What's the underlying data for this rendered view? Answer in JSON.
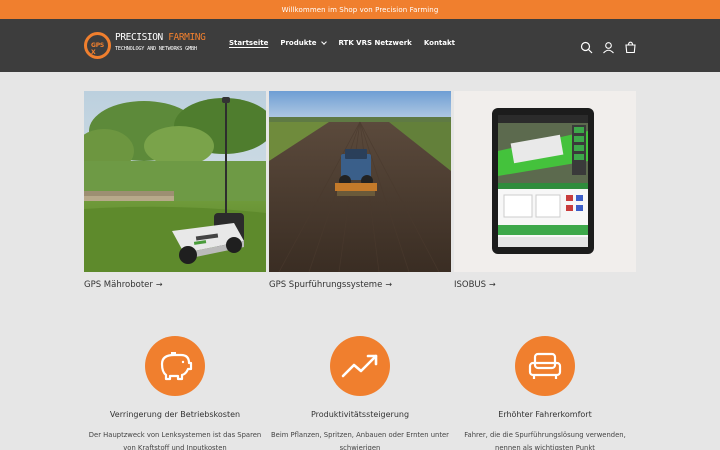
{
  "announcement": "Willkommen im Shop von Precision Farming",
  "logo": {
    "mark": "GPS X",
    "line1_a": "PRECISION ",
    "line1_b": "FARMING",
    "line2": "TECHNOLOGY AND NETWORKS GMBH"
  },
  "nav": {
    "items": [
      {
        "label": "Startseite",
        "active": true
      },
      {
        "label": "Produkte",
        "dropdown": true
      },
      {
        "label": "RTK VRS Netzwerk"
      },
      {
        "label": "Kontakt"
      }
    ]
  },
  "header_icons": [
    "search-icon",
    "account-icon",
    "cart-icon"
  ],
  "collections": [
    {
      "title": "GPS Mähroboter",
      "image": "robot-mower-lawn"
    },
    {
      "title": "GPS Spurführungssysteme",
      "image": "tractor-field"
    },
    {
      "title": "ISOBUS",
      "image": "isobus-tablet"
    }
  ],
  "features": [
    {
      "title": "Verringerung der Betriebskosten",
      "text": "Der Hauptzweck von Lenksystemen ist das Sparen von Kraftstoff und Inputkosten",
      "icon": "piggy-bank-icon"
    },
    {
      "title": "Produktivitätssteigerung",
      "text": "Beim Pflanzen, Spritzen, Anbauen oder Ernten unter schwierigen",
      "icon": "trend-up-icon"
    },
    {
      "title": "Erhöhter Fahrerkomfort",
      "text": "Fahrer, die die Spurführungslösung verwenden, nennen als wichtigsten Punkt",
      "icon": "armchair-icon"
    }
  ],
  "colors": {
    "accent": "#f07f2e",
    "header_bg": "#3d3d3d",
    "page_bg": "#e6e6e6"
  }
}
